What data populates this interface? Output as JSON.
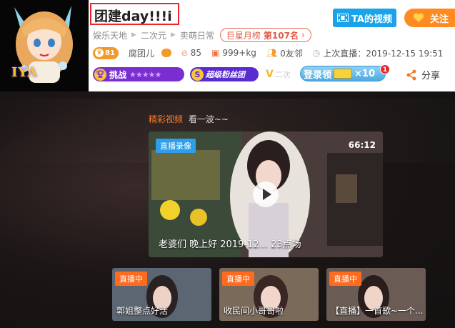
{
  "room": {
    "title": "团建day!!!i",
    "avatar_text": "IYA"
  },
  "header": {
    "video_button": "TA的视频",
    "follow_button": "关注",
    "categories": [
      "娱乐天地",
      "二次元",
      "卖萌日常"
    ],
    "rank_badge": {
      "label": "巨星月榜",
      "value": "第107名"
    },
    "level_badge": "81",
    "streamer_name": "腐团儿",
    "heat": "85",
    "weight": "999+kg",
    "neighbors": "0友邻",
    "last_live": "上次直播：2019-12-15 19:51",
    "challenge_label": "挑战",
    "challenge_stars": "★★★★★",
    "fans_label": "超级粉丝团",
    "v_text": "二次",
    "login_reward": "登录领",
    "login_reward_count": "×10",
    "notification_count": "1",
    "share_label": "分享"
  },
  "highlights": {
    "section_title": "精彩视频",
    "section_subtitle": "看一波~~",
    "feature": {
      "tag": "直播录像",
      "duration": "66:12",
      "caption": "老婆们 晚上好 2019-12...   23点场"
    },
    "live_thumbs": [
      {
        "tag": "直播中",
        "caption": "郭姐整点好活"
      },
      {
        "tag": "直播中",
        "caption": "收民间小哥哥啦"
      },
      {
        "tag": "直播中",
        "caption": "【直播】一首歌~一个..."
      }
    ]
  },
  "colors": {
    "accent_orange": "#ff8a1f",
    "video_blue": "#1aa3e8",
    "title_border": "#e8262c",
    "rank_red": "#e45a48",
    "challenge_purple": "#7b2ed0",
    "live_orange": "#ff6b1e"
  }
}
